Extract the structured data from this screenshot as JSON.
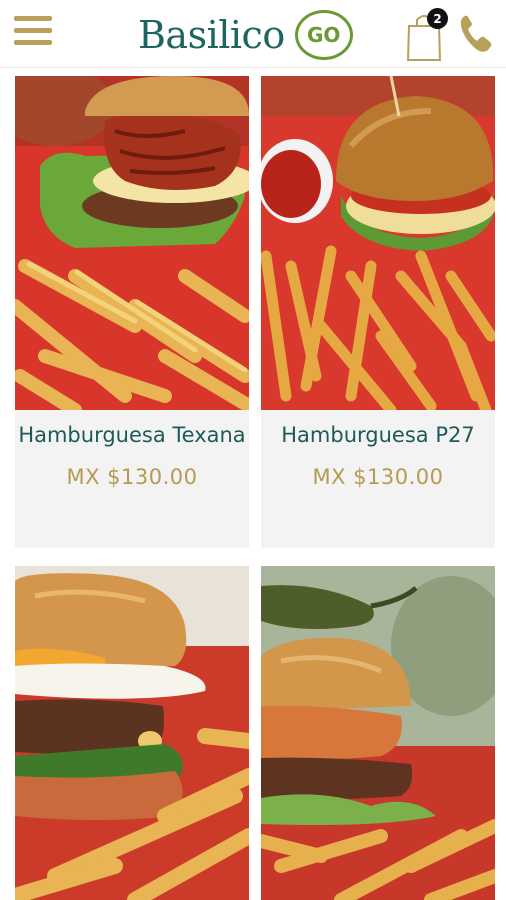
{
  "header": {
    "brand": "Basilico",
    "brand_badge": "GO",
    "cart_count": "2",
    "icons": {
      "menu": "hamburger-menu-icon",
      "cart": "shopping-bag-icon",
      "call": "phone-icon"
    },
    "colors": {
      "gold": "#b9a05a",
      "teal": "#1e6560",
      "green": "#6a9a34"
    }
  },
  "products": [
    {
      "name": "Hamburguesa Texana",
      "price": "MX $130.00"
    },
    {
      "name": "Hamburguesa P27",
      "price": "MX $130.00"
    },
    {
      "name": "",
      "price": ""
    },
    {
      "name": "",
      "price": ""
    }
  ]
}
